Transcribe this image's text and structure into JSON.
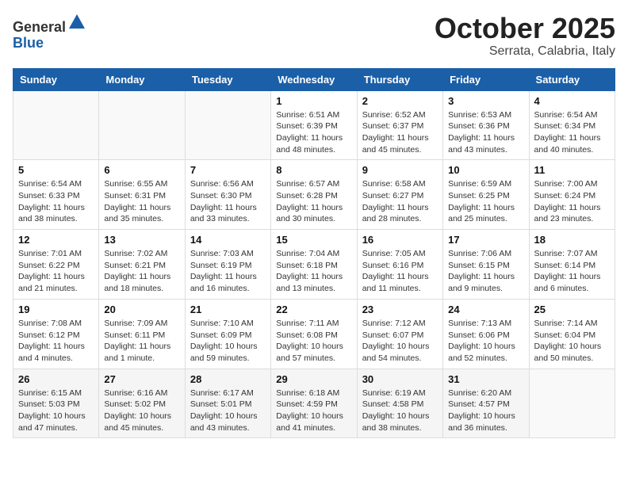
{
  "header": {
    "logo_general": "General",
    "logo_blue": "Blue",
    "month": "October 2025",
    "location": "Serrata, Calabria, Italy"
  },
  "days_of_week": [
    "Sunday",
    "Monday",
    "Tuesday",
    "Wednesday",
    "Thursday",
    "Friday",
    "Saturday"
  ],
  "weeks": [
    [
      {
        "day": "",
        "info": ""
      },
      {
        "day": "",
        "info": ""
      },
      {
        "day": "",
        "info": ""
      },
      {
        "day": "1",
        "info": "Sunrise: 6:51 AM\nSunset: 6:39 PM\nDaylight: 11 hours\nand 48 minutes."
      },
      {
        "day": "2",
        "info": "Sunrise: 6:52 AM\nSunset: 6:37 PM\nDaylight: 11 hours\nand 45 minutes."
      },
      {
        "day": "3",
        "info": "Sunrise: 6:53 AM\nSunset: 6:36 PM\nDaylight: 11 hours\nand 43 minutes."
      },
      {
        "day": "4",
        "info": "Sunrise: 6:54 AM\nSunset: 6:34 PM\nDaylight: 11 hours\nand 40 minutes."
      }
    ],
    [
      {
        "day": "5",
        "info": "Sunrise: 6:54 AM\nSunset: 6:33 PM\nDaylight: 11 hours\nand 38 minutes."
      },
      {
        "day": "6",
        "info": "Sunrise: 6:55 AM\nSunset: 6:31 PM\nDaylight: 11 hours\nand 35 minutes."
      },
      {
        "day": "7",
        "info": "Sunrise: 6:56 AM\nSunset: 6:30 PM\nDaylight: 11 hours\nand 33 minutes."
      },
      {
        "day": "8",
        "info": "Sunrise: 6:57 AM\nSunset: 6:28 PM\nDaylight: 11 hours\nand 30 minutes."
      },
      {
        "day": "9",
        "info": "Sunrise: 6:58 AM\nSunset: 6:27 PM\nDaylight: 11 hours\nand 28 minutes."
      },
      {
        "day": "10",
        "info": "Sunrise: 6:59 AM\nSunset: 6:25 PM\nDaylight: 11 hours\nand 25 minutes."
      },
      {
        "day": "11",
        "info": "Sunrise: 7:00 AM\nSunset: 6:24 PM\nDaylight: 11 hours\nand 23 minutes."
      }
    ],
    [
      {
        "day": "12",
        "info": "Sunrise: 7:01 AM\nSunset: 6:22 PM\nDaylight: 11 hours\nand 21 minutes."
      },
      {
        "day": "13",
        "info": "Sunrise: 7:02 AM\nSunset: 6:21 PM\nDaylight: 11 hours\nand 18 minutes."
      },
      {
        "day": "14",
        "info": "Sunrise: 7:03 AM\nSunset: 6:19 PM\nDaylight: 11 hours\nand 16 minutes."
      },
      {
        "day": "15",
        "info": "Sunrise: 7:04 AM\nSunset: 6:18 PM\nDaylight: 11 hours\nand 13 minutes."
      },
      {
        "day": "16",
        "info": "Sunrise: 7:05 AM\nSunset: 6:16 PM\nDaylight: 11 hours\nand 11 minutes."
      },
      {
        "day": "17",
        "info": "Sunrise: 7:06 AM\nSunset: 6:15 PM\nDaylight: 11 hours\nand 9 minutes."
      },
      {
        "day": "18",
        "info": "Sunrise: 7:07 AM\nSunset: 6:14 PM\nDaylight: 11 hours\nand 6 minutes."
      }
    ],
    [
      {
        "day": "19",
        "info": "Sunrise: 7:08 AM\nSunset: 6:12 PM\nDaylight: 11 hours\nand 4 minutes."
      },
      {
        "day": "20",
        "info": "Sunrise: 7:09 AM\nSunset: 6:11 PM\nDaylight: 11 hours\nand 1 minute."
      },
      {
        "day": "21",
        "info": "Sunrise: 7:10 AM\nSunset: 6:09 PM\nDaylight: 10 hours\nand 59 minutes."
      },
      {
        "day": "22",
        "info": "Sunrise: 7:11 AM\nSunset: 6:08 PM\nDaylight: 10 hours\nand 57 minutes."
      },
      {
        "day": "23",
        "info": "Sunrise: 7:12 AM\nSunset: 6:07 PM\nDaylight: 10 hours\nand 54 minutes."
      },
      {
        "day": "24",
        "info": "Sunrise: 7:13 AM\nSunset: 6:06 PM\nDaylight: 10 hours\nand 52 minutes."
      },
      {
        "day": "25",
        "info": "Sunrise: 7:14 AM\nSunset: 6:04 PM\nDaylight: 10 hours\nand 50 minutes."
      }
    ],
    [
      {
        "day": "26",
        "info": "Sunrise: 6:15 AM\nSunset: 5:03 PM\nDaylight: 10 hours\nand 47 minutes."
      },
      {
        "day": "27",
        "info": "Sunrise: 6:16 AM\nSunset: 5:02 PM\nDaylight: 10 hours\nand 45 minutes."
      },
      {
        "day": "28",
        "info": "Sunrise: 6:17 AM\nSunset: 5:01 PM\nDaylight: 10 hours\nand 43 minutes."
      },
      {
        "day": "29",
        "info": "Sunrise: 6:18 AM\nSunset: 4:59 PM\nDaylight: 10 hours\nand 41 minutes."
      },
      {
        "day": "30",
        "info": "Sunrise: 6:19 AM\nSunset: 4:58 PM\nDaylight: 10 hours\nand 38 minutes."
      },
      {
        "day": "31",
        "info": "Sunrise: 6:20 AM\nSunset: 4:57 PM\nDaylight: 10 hours\nand 36 minutes."
      },
      {
        "day": "",
        "info": ""
      }
    ]
  ]
}
